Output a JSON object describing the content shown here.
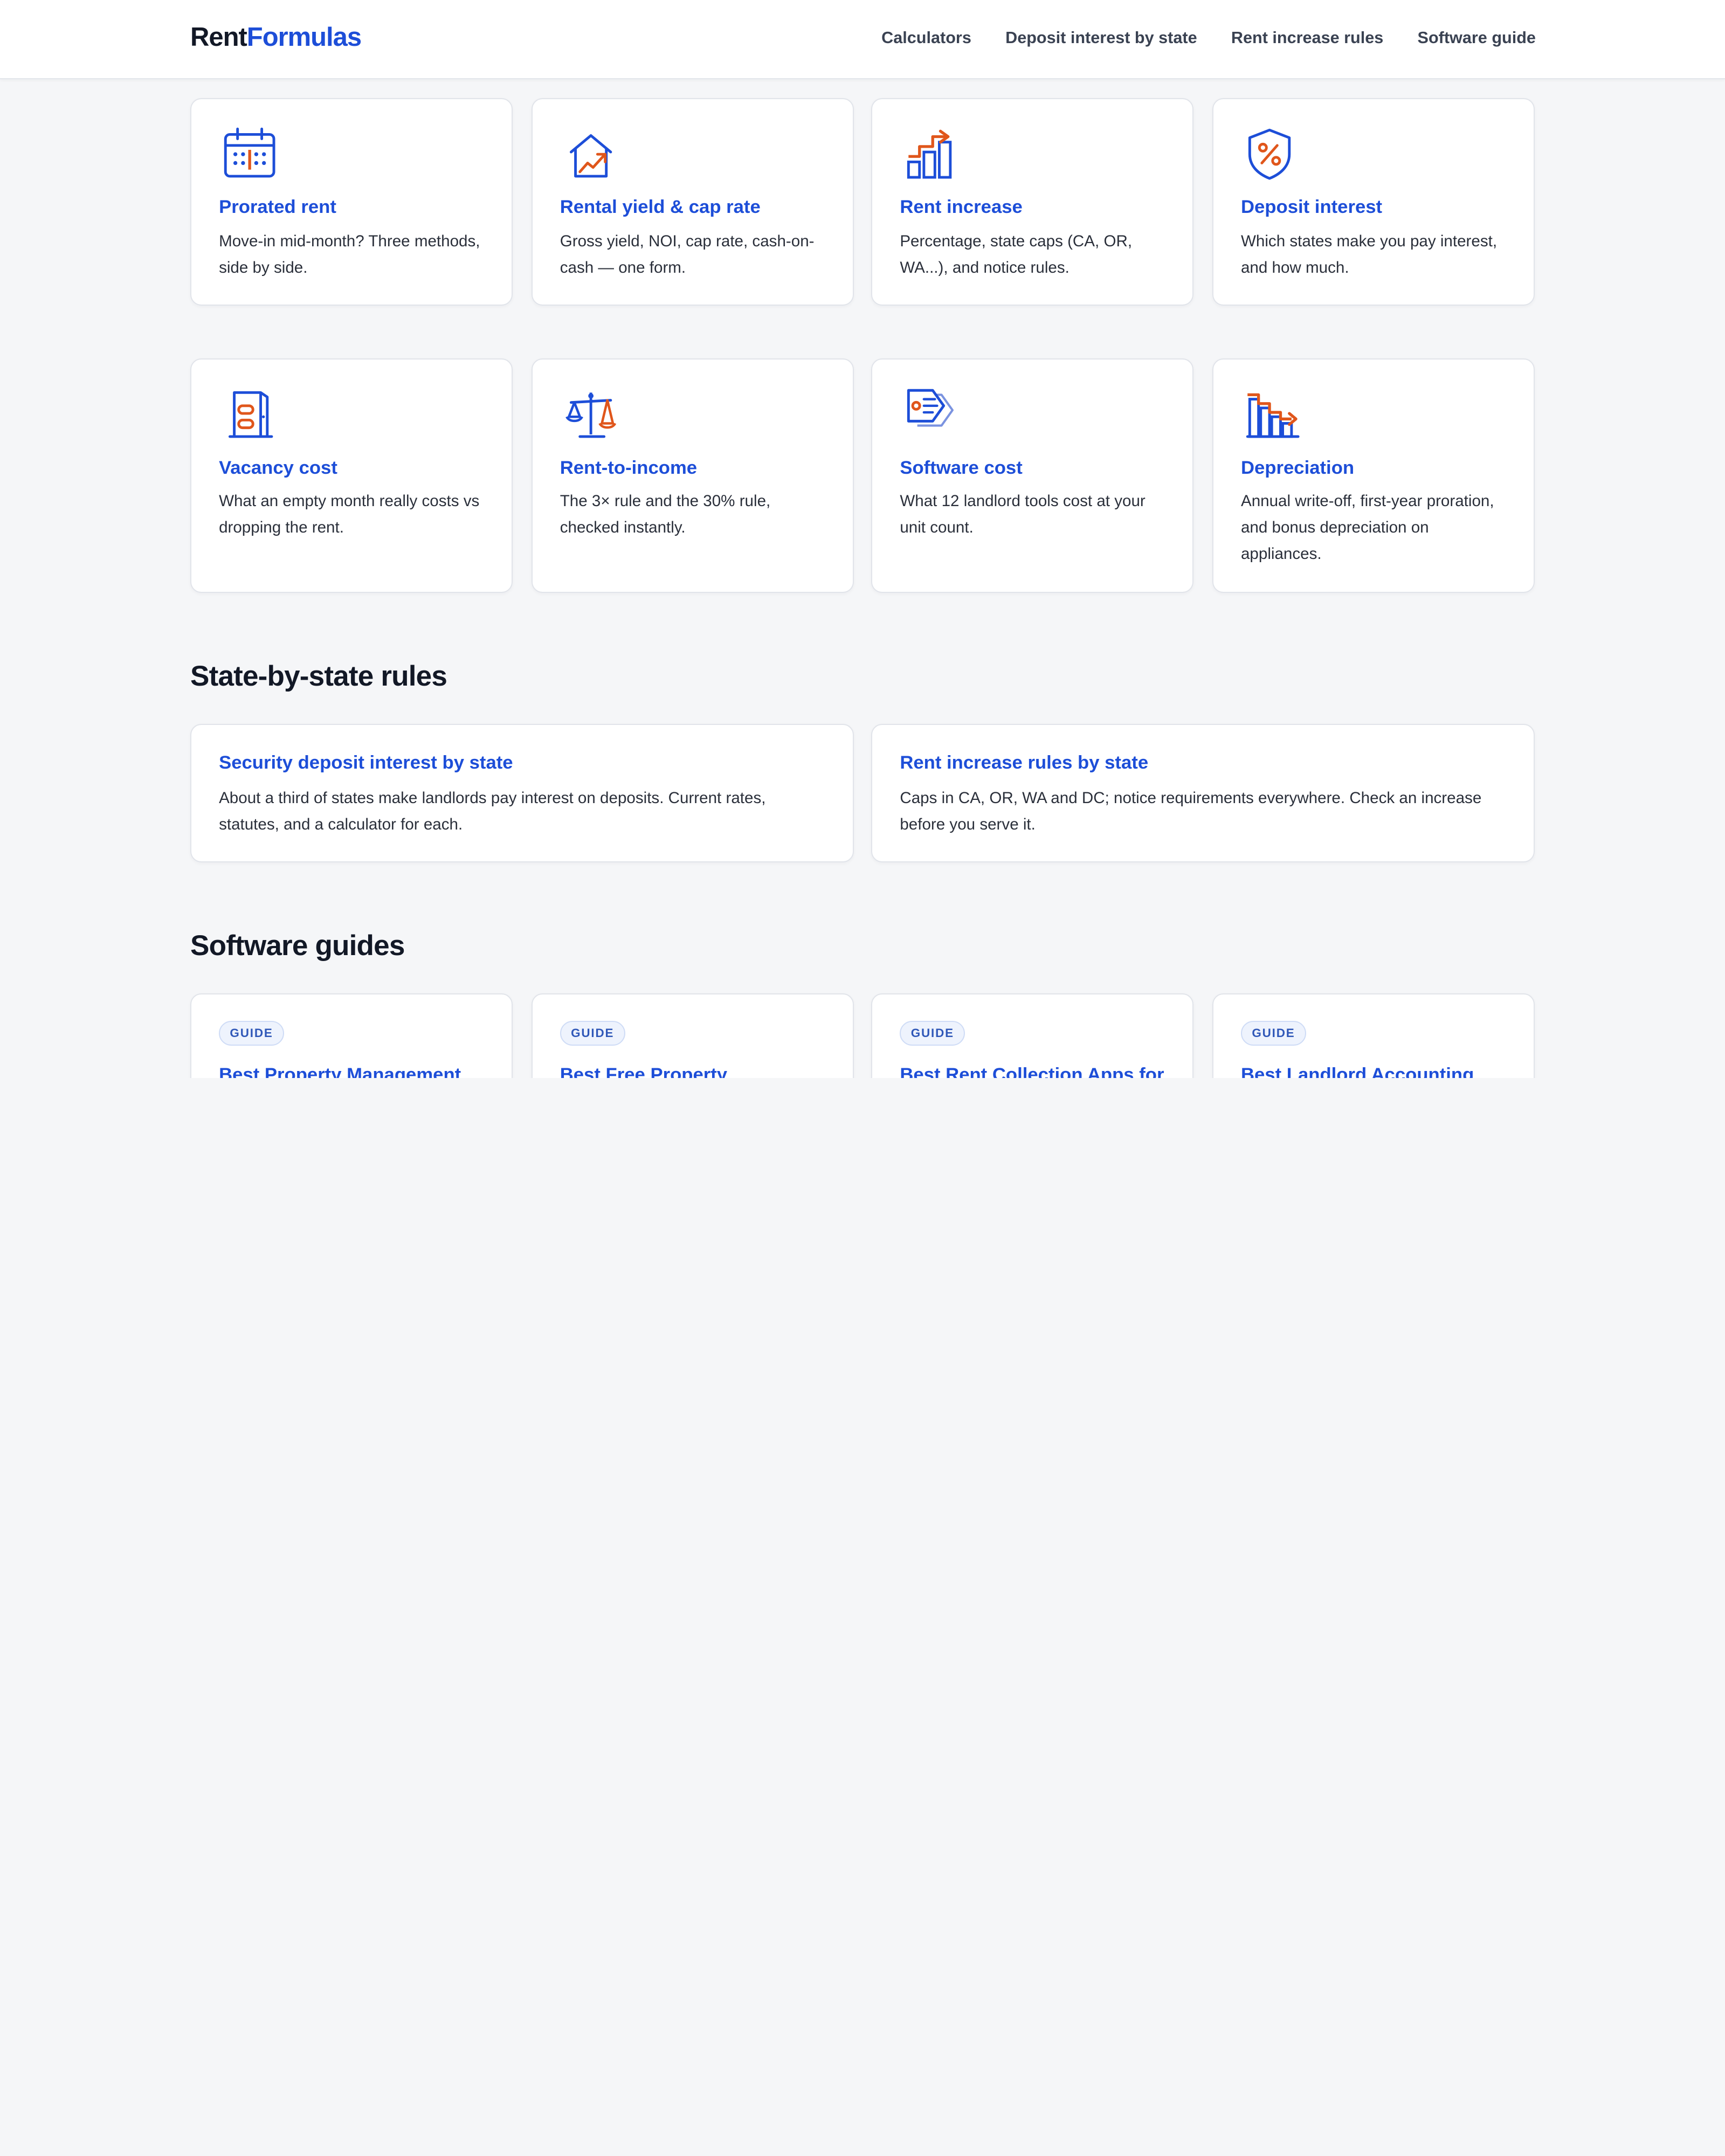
{
  "header": {
    "logo_part1": "Rent",
    "logo_part2": "Formulas",
    "nav": [
      "Calculators",
      "Deposit interest by state",
      "Rent increase rules",
      "Software guide"
    ]
  },
  "calculators": [
    {
      "title": "Prorated rent",
      "desc": "Move-in mid-month? Three methods, side by side.",
      "icon": "calendar-icon"
    },
    {
      "title": "Rental yield & cap rate",
      "desc": "Gross yield, NOI, cap rate, cash-on-cash — one form.",
      "icon": "house-chart-icon"
    },
    {
      "title": "Rent increase",
      "desc": "Percentage, state caps (CA, OR, WA...), and notice rules.",
      "icon": "bar-chart-up-icon"
    },
    {
      "title": "Deposit interest",
      "desc": "Which states make you pay interest, and how much.",
      "icon": "shield-percent-icon"
    },
    {
      "title": "Vacancy cost",
      "desc": "What an empty month really costs vs dropping the rent.",
      "icon": "door-icon"
    },
    {
      "title": "Rent-to-income",
      "desc": "The 3× rule and the 30% rule, checked instantly.",
      "icon": "scales-icon"
    },
    {
      "title": "Software cost",
      "desc": "What 12 landlord tools cost at your unit count.",
      "icon": "price-tag-icon"
    },
    {
      "title": "Depreciation",
      "desc": "Annual write-off, first-year proration, and bonus depreciation on appliances.",
      "icon": "bar-chart-down-icon"
    }
  ],
  "state_section": {
    "title": "State-by-state rules",
    "cards": [
      {
        "title": "Security deposit interest by state",
        "desc": "About a third of states make landlords pay interest on deposits. Current rates, statutes, and a calculator for each."
      },
      {
        "title": "Rent increase rules by state",
        "desc": "Caps in CA, OR, WA and DC; notice requirements everywhere. Check an increase before you serve it."
      }
    ]
  },
  "guides_section": {
    "title": "Software guides",
    "guides": [
      {
        "badge": "GUIDE",
        "title": "Best Property Management"
      },
      {
        "badge": "GUIDE",
        "title": "Best Free Property"
      },
      {
        "badge": "GUIDE",
        "title": "Best Rent Collection Apps for"
      },
      {
        "badge": "GUIDE",
        "title": "Best Landlord Accounting"
      }
    ]
  },
  "colors": {
    "brand_blue": "#1d4ed8",
    "accent_orange": "#e0561b",
    "background": "#f5f6f8"
  }
}
